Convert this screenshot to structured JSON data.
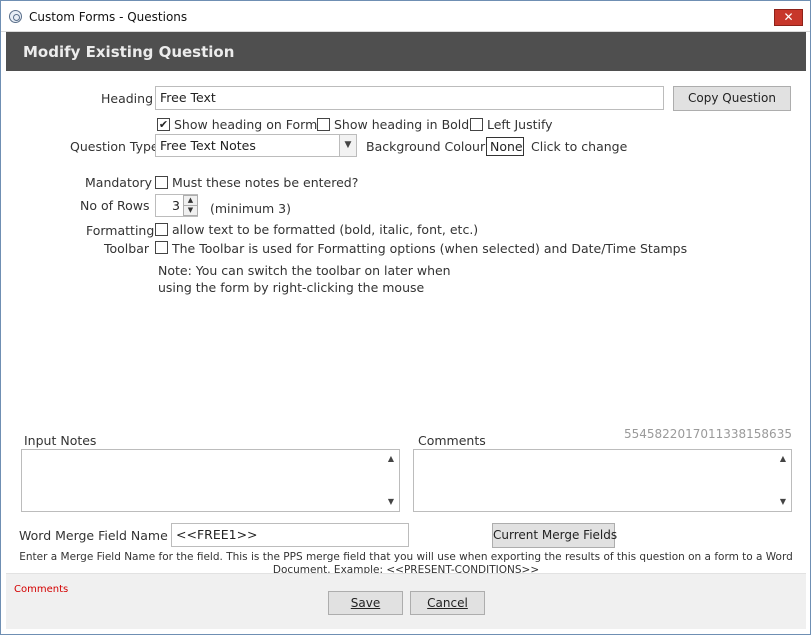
{
  "window": {
    "title": "Custom Forms - Questions",
    "close_label": "✕"
  },
  "header": {
    "title": "Modify Existing Question"
  },
  "form": {
    "heading_label": "Heading",
    "heading_value": "Free Text",
    "copy_question_label": "Copy Question",
    "show_heading_on_form": {
      "label": "Show heading on Form",
      "checked": "✔"
    },
    "show_heading_bold": {
      "label": "Show heading in Bold",
      "checked": ""
    },
    "left_justify": {
      "label": "Left Justify",
      "checked": ""
    },
    "question_type_label": "Question Type",
    "question_type_value": "Free Text Notes",
    "background_colour_label": "Background Colour",
    "background_colour_value": "None",
    "click_to_change": "Click to change",
    "mandatory_label": "Mandatory",
    "mandatory_option": "Must these notes be entered?",
    "rows_label": "No of Rows",
    "rows_value": "3",
    "rows_hint": "(minimum 3)",
    "formatting_label": "Formatting",
    "formatting_option": "allow text to be formatted (bold, italic, font, etc.)",
    "toolbar_label": "Toolbar",
    "toolbar_option": "The Toolbar is used for Formatting options (when selected) and Date/Time Stamps",
    "note_line1": "Note: You can switch the toolbar on later when",
    "note_line2": "using the form by right-clicking the mouse",
    "input_notes_label": "Input Notes",
    "comments_label": "Comments",
    "record_id": "5545822017011338158635",
    "merge_field_label": "Word Merge Field Name",
    "merge_field_value": "<<FREE1>>",
    "current_merge_fields_label": "Current Merge Fields",
    "merge_help_line1": "Enter a Merge Field Name for the field. This is the PPS merge field that you will use when exporting the results of this question on a form to a Word",
    "merge_help_line2": "Document. Example: <<PRESENT-CONDITIONS>>"
  },
  "footer": {
    "comments_link": "Comments",
    "save_label": "Save",
    "cancel_label": "Cancel"
  },
  "colors": {
    "header_band": "#4f4f4f",
    "close_button": "#c7372b",
    "comments_link": "#d40000",
    "record_id": "#9a9a9a"
  }
}
